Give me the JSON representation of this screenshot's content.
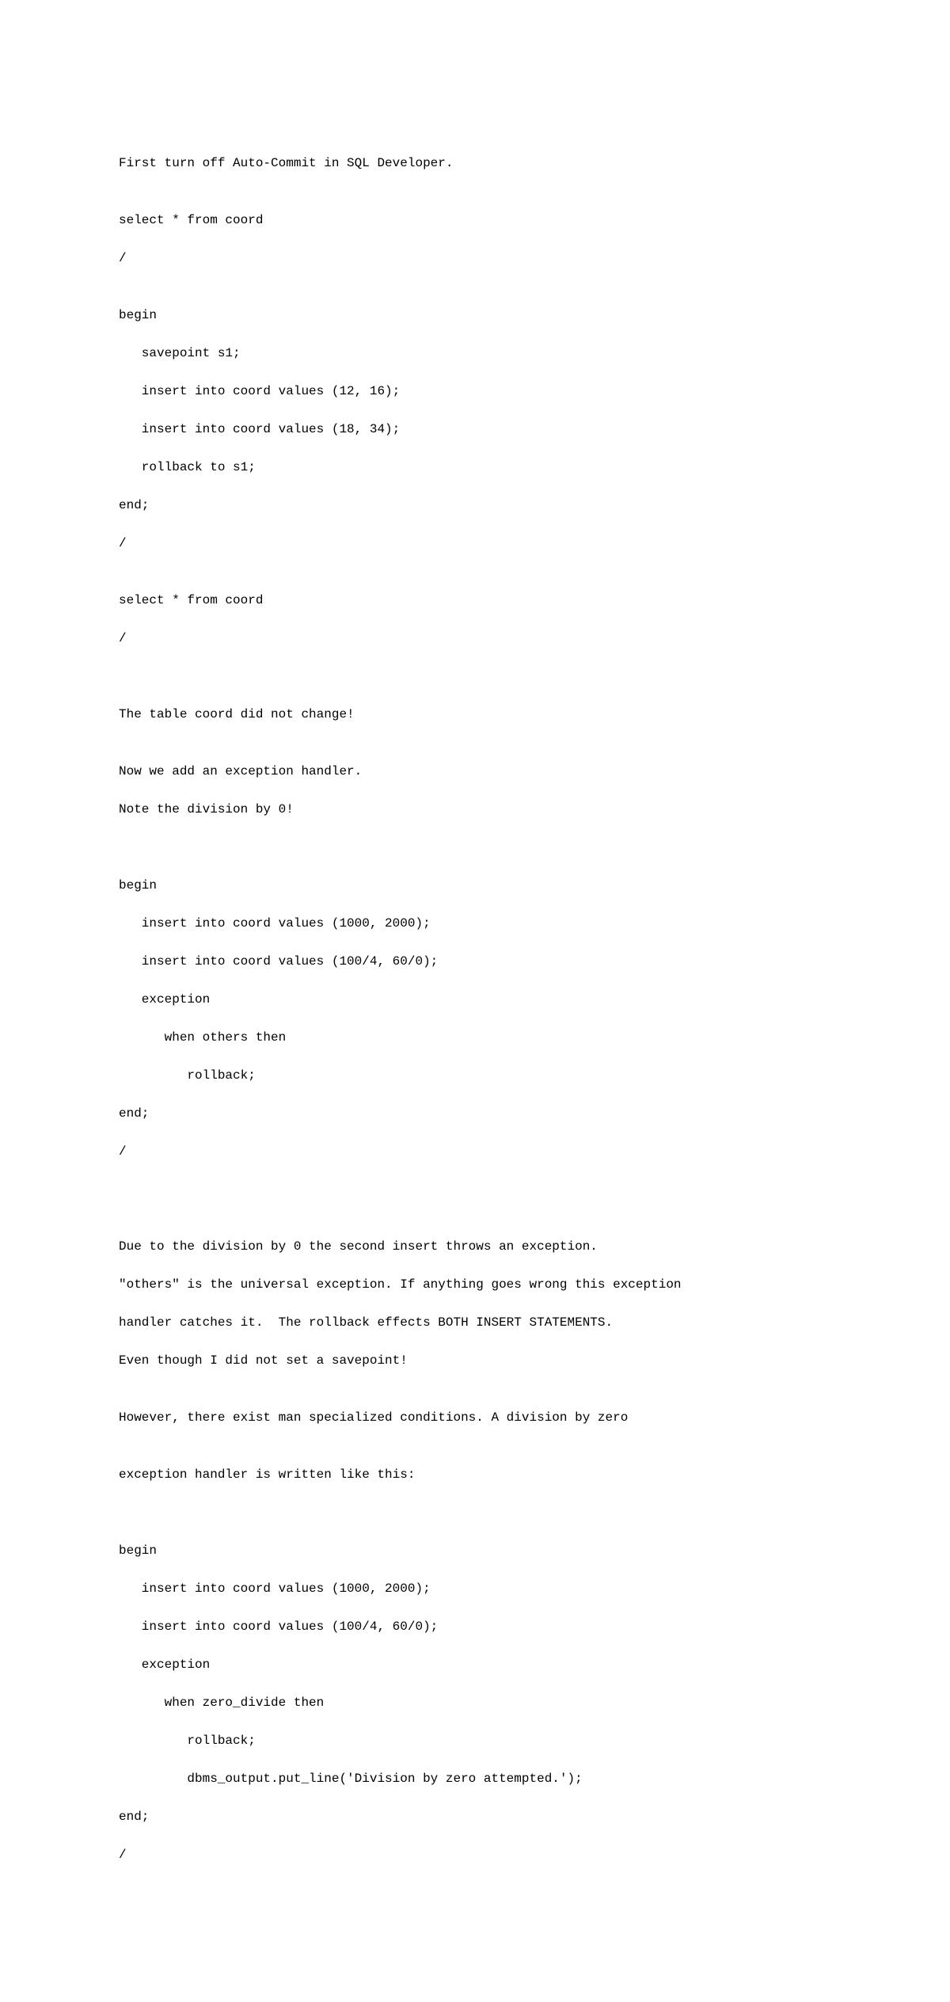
{
  "doc": {
    "l01": "First turn off Auto-Commit in SQL Developer.",
    "l02": "",
    "l03": "select * from coord",
    "l04": "/",
    "l05": "",
    "l06": "begin",
    "l07": "   savepoint s1;",
    "l08": "   insert into coord values (12, 16);",
    "l09": "   insert into coord values (18, 34);",
    "l10": "   rollback to s1;",
    "l11": "end;",
    "l12": "/",
    "l13": "",
    "l14": "select * from coord",
    "l15": "/",
    "l16": "",
    "l17": "",
    "l18": "The table coord did not change!",
    "l19": "",
    "l20": "Now we add an exception handler.",
    "l21": "Note the division by 0!",
    "l22": "",
    "l23": "",
    "l24": "begin",
    "l25": "   insert into coord values (1000, 2000);",
    "l26": "   insert into coord values (100/4, 60/0);",
    "l27": "   exception",
    "l28": "      when others then",
    "l29": "         rollback;",
    "l30": "end;",
    "l31": "/",
    "l32": "",
    "l33": "",
    "l34": "",
    "l35": "Due to the division by 0 the second insert throws an exception.",
    "l36": "\"others\" is the universal exception. If anything goes wrong this exception",
    "l37": "handler catches it.  The rollback effects BOTH INSERT STATEMENTS.",
    "l38": "Even though I did not set a savepoint!",
    "l39": "",
    "l40": "However, there exist man specialized conditions. A division by zero",
    "l41": "",
    "l42": "exception handler is written like this:",
    "l43": "",
    "l44": "",
    "l45": "begin",
    "l46": "   insert into coord values (1000, 2000);",
    "l47": "   insert into coord values (100/4, 60/0);",
    "l48": "   exception",
    "l49": "      when zero_divide then",
    "l50": "         rollback;",
    "l51": "         dbms_output.put_line('Division by zero attempted.');",
    "l52": "end;",
    "l53": "/"
  }
}
